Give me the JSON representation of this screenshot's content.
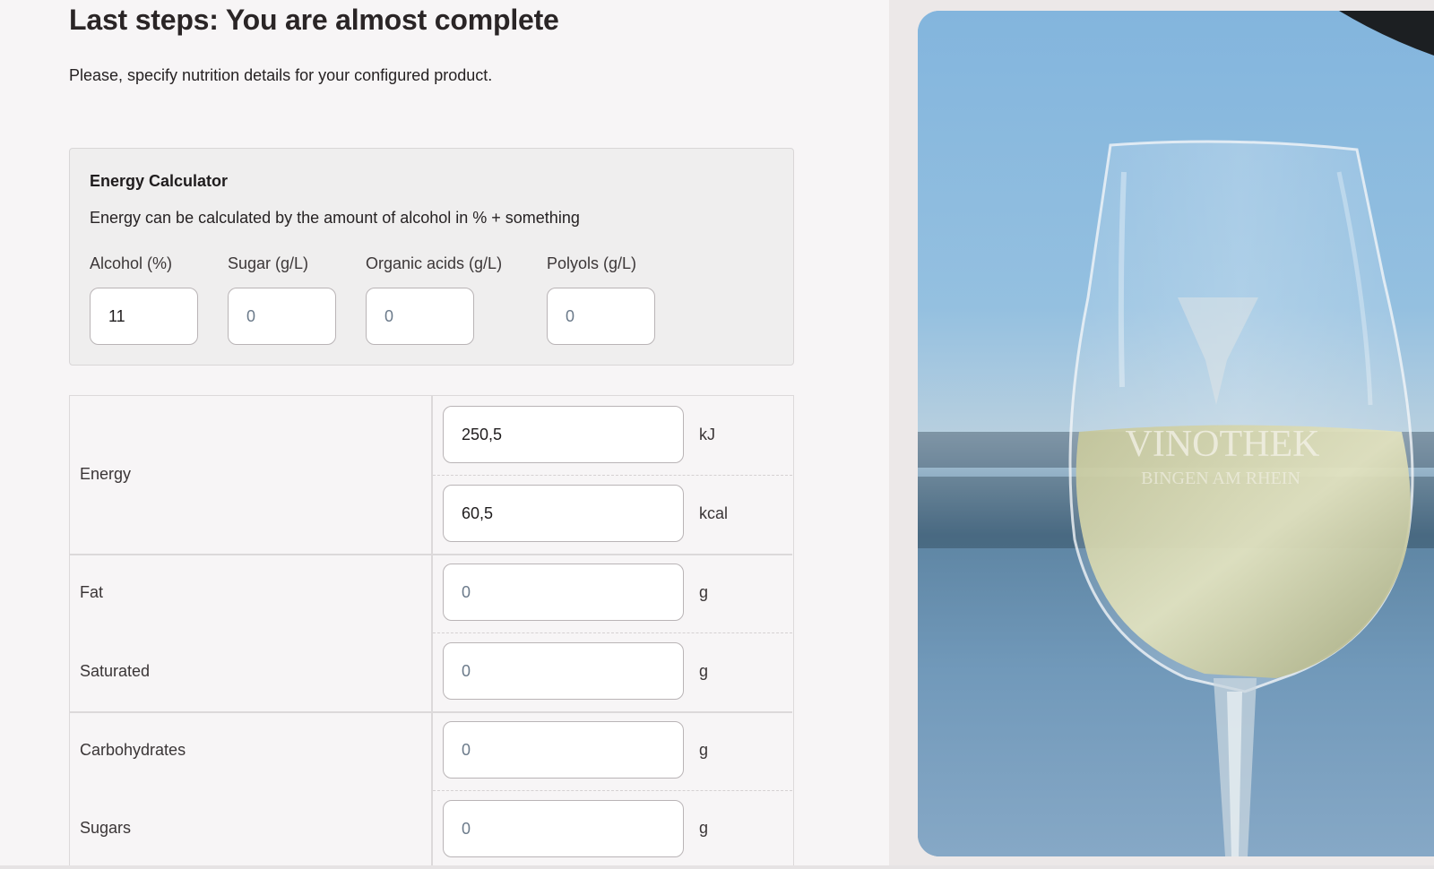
{
  "page": {
    "title": "Last steps: You are almost complete",
    "subtitle": "Please, specify nutrition details for your configured product."
  },
  "calculator": {
    "title": "Energy Calculator",
    "description": "Energy can be calculated by the amount of alcohol in % + something",
    "fields": [
      {
        "label": "Alcohol (%)",
        "value": "11",
        "placeholder": ""
      },
      {
        "label": "Sugar (g/L)",
        "value": "",
        "placeholder": "0"
      },
      {
        "label": "Organic acids (g/L)",
        "value": "",
        "placeholder": "0"
      },
      {
        "label": "Polyols (g/L)",
        "value": "",
        "placeholder": "0"
      }
    ]
  },
  "nutrition": {
    "energy": {
      "label": "Energy",
      "kj_value": "250,5",
      "kj_unit": "kJ",
      "kcal_value": "60,5",
      "kcal_unit": "kcal"
    },
    "fat": {
      "label": "Fat",
      "placeholder": "0",
      "unit": "g"
    },
    "saturated": {
      "label": "Saturated",
      "placeholder": "0",
      "unit": "g"
    },
    "carbohydrates": {
      "label": "Carbohydrates",
      "placeholder": "0",
      "unit": "g"
    },
    "sugars": {
      "label": "Sugars",
      "placeholder": "0",
      "unit": "g"
    }
  },
  "photo": {
    "engraving_line1": "VINOTHEK",
    "engraving_line2": "BINGEN AM RHEIN"
  }
}
